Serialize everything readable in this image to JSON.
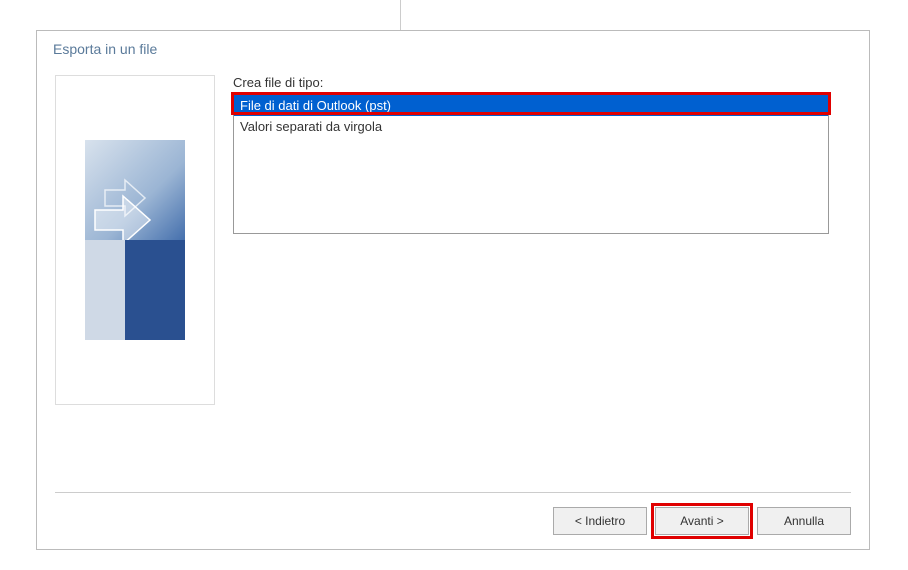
{
  "dialog": {
    "title": "Esporta in un file",
    "field_label": "Crea file di tipo:",
    "options": {
      "pst": "File di dati di Outlook (pst)",
      "csv": "Valori separati da virgola"
    },
    "buttons": {
      "back": "< Indietro",
      "next": "Avanti >",
      "cancel": "Annulla"
    }
  }
}
